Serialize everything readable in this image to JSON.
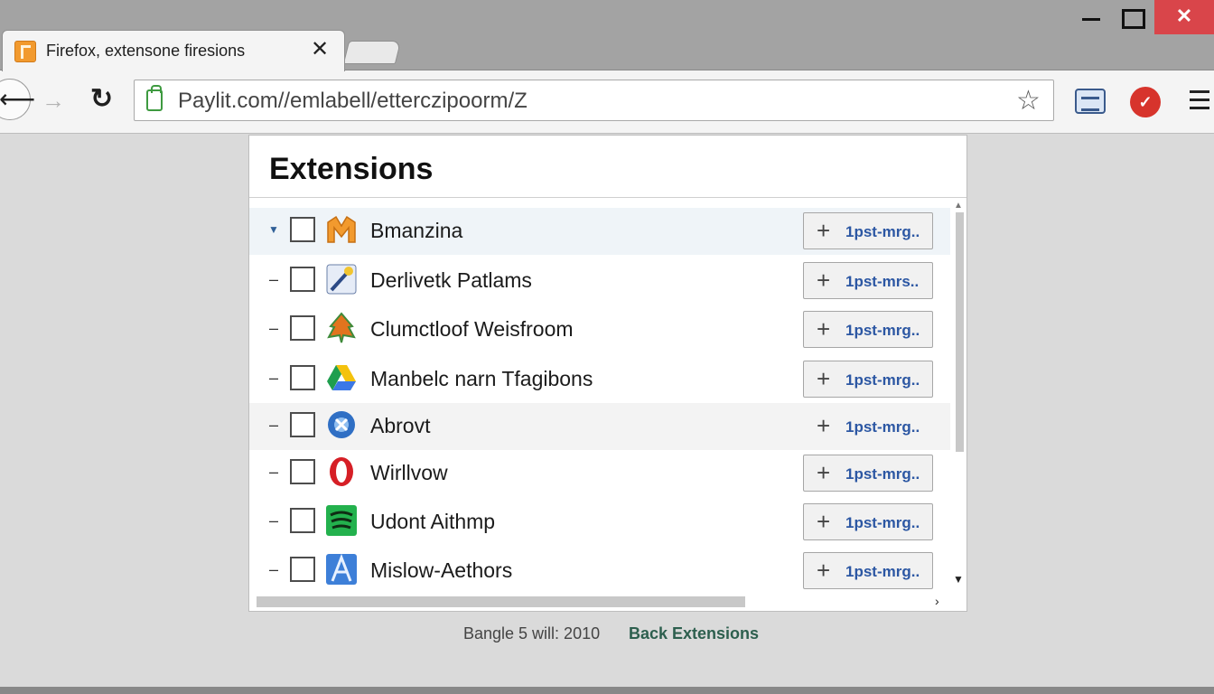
{
  "window": {
    "tab_title": "Firefox, extensone firesions",
    "tab_close": "✕",
    "close_glyph": "✕",
    "close_color": "#d9454a"
  },
  "toolbar": {
    "back_glyph": "⟵",
    "forward_glyph": "→",
    "reload_glyph": "↻",
    "url": "Paylit.com//emlabell/etterczipoorm/Z",
    "star_glyph": "☆",
    "ext_badge_glyph": "✓",
    "ext_badge_color": "#d7342c"
  },
  "panel": {
    "title": "Extensions",
    "rows": [
      {
        "name": "Bmanzina",
        "button": "1pst-mrg..",
        "icon": "orange-m-icon",
        "expanded": true,
        "highlight": true
      },
      {
        "name": "Derlivetk Patlams",
        "button": "1pst-mrs..",
        "icon": "wand-icon"
      },
      {
        "name": "Clumctloof Weisfroom",
        "button": "1pst-mrg..",
        "icon": "leaf-icon"
      },
      {
        "name": "Manbelc narn Tfagibons",
        "button": "1pst-mrg..",
        "icon": "drive-triangle-icon"
      },
      {
        "name": "Abrovt",
        "button": "1pst-mrg..",
        "icon": "blue-orb-icon",
        "alt": true
      },
      {
        "name": "Wirllvow",
        "button": "1pst-mrg..",
        "icon": "opera-o-icon"
      },
      {
        "name": "Udont Aithmp",
        "button": "1pst-mrg..",
        "icon": "green-waves-icon"
      },
      {
        "name": "Mislow-Aethors",
        "button": "1pst-mrg..",
        "icon": "blue-a-icon"
      }
    ],
    "collapse_glyph": "–",
    "expand_glyph": "▼",
    "add_glyph": "+"
  },
  "footer": {
    "status": "Bangle 5 will: 2010",
    "link": "Back Extensions"
  },
  "colors": {
    "accent_link": "#2c57a3",
    "footer_link": "#2d5f4e",
    "row_highlight": "#eff4f8"
  }
}
